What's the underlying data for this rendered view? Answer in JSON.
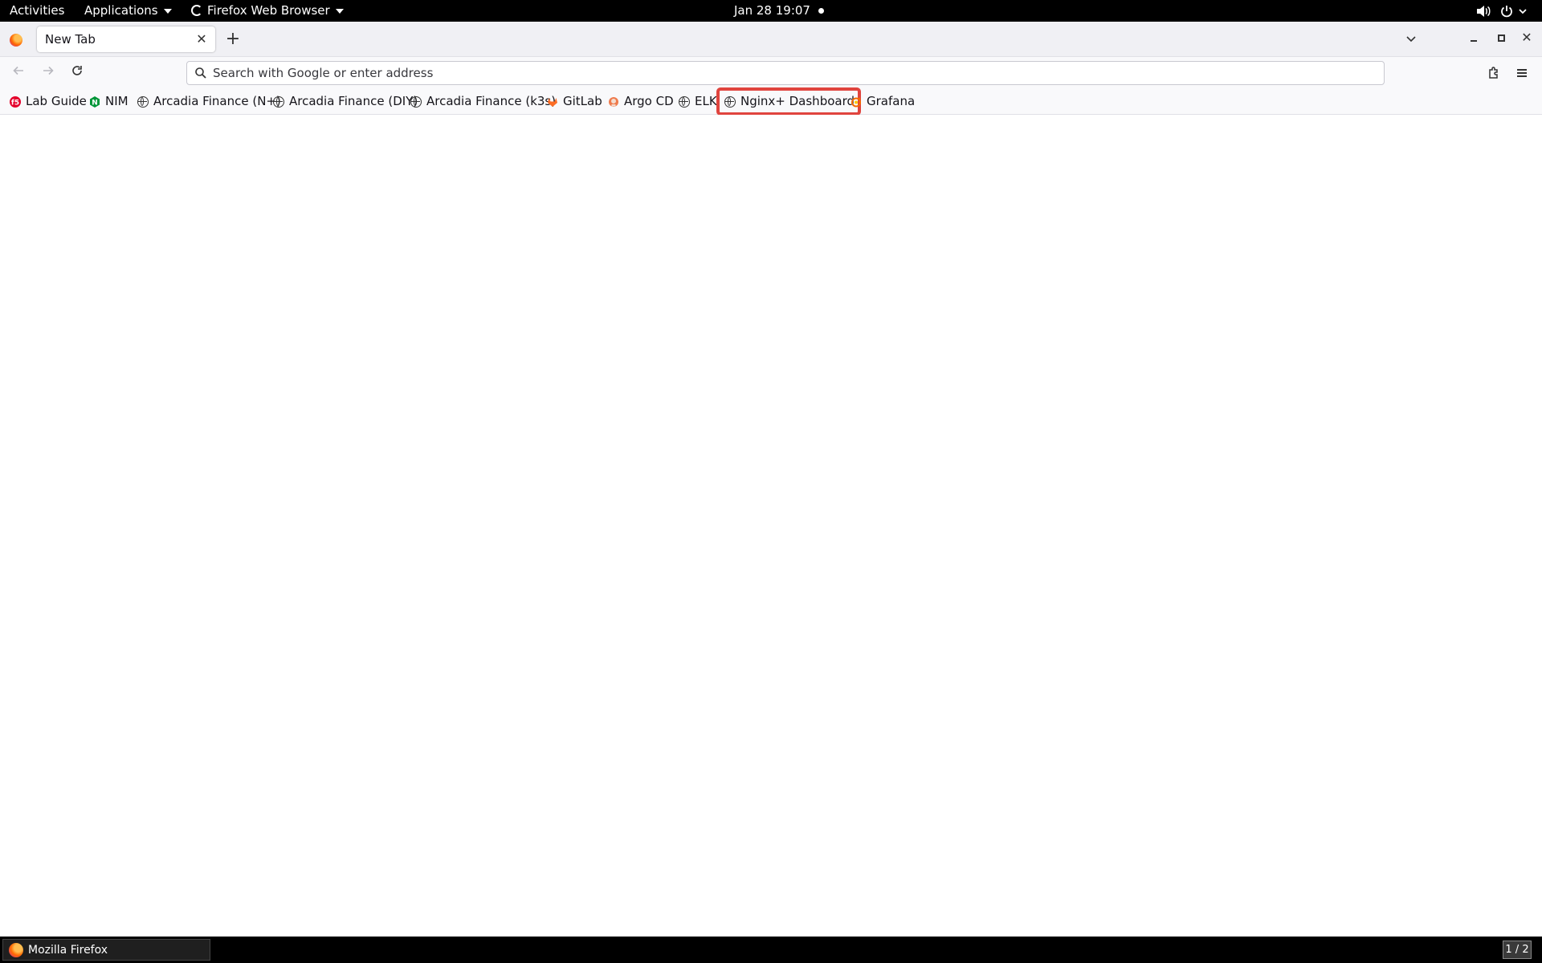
{
  "topbar": {
    "activities": "Activities",
    "applications": "Applications",
    "app_name": "Firefox Web Browser",
    "clock": "Jan 28  19:07"
  },
  "browser": {
    "tab_title": "New Tab",
    "urlbar_placeholder": "Search with Google or enter address"
  },
  "bookmarks": [
    {
      "label": "Lab Guide",
      "icon": "f5-icon"
    },
    {
      "label": "NIM",
      "icon": "nginx-icon"
    },
    {
      "label": "Arcadia Finance (N+)",
      "icon": "globe-icon"
    },
    {
      "label": "Arcadia Finance (DIY)",
      "icon": "globe-icon"
    },
    {
      "label": "Arcadia Finance (k3s)",
      "icon": "globe-icon"
    },
    {
      "label": "GitLab",
      "icon": "gitlab-icon"
    },
    {
      "label": "Argo CD",
      "icon": "argocd-icon"
    },
    {
      "label": "ELK",
      "icon": "globe-icon"
    },
    {
      "label": "Nginx+ Dashboard",
      "icon": "globe-icon"
    },
    {
      "label": "Grafana",
      "icon": "grafana-icon"
    }
  ],
  "taskbar": {
    "window_label": "Mozilla Firefox",
    "workspace": "1 / 2"
  },
  "colors": {
    "highlight": "#e0443e",
    "gitlab": "#fc6d26",
    "grafana": "#f46800",
    "nginx": "#009639",
    "f5": "#e4002b"
  }
}
